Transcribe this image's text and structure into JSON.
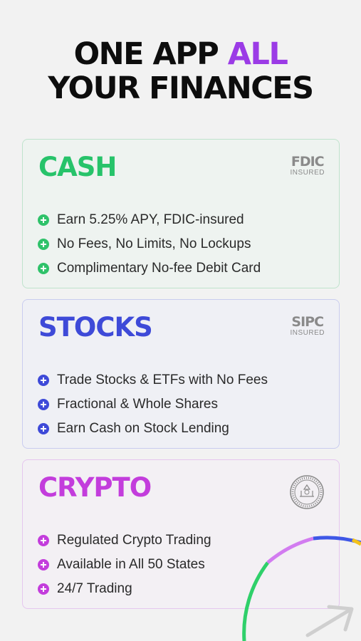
{
  "headline": {
    "line1_prefix": "ONE APP ",
    "line1_accent": "ALL",
    "line2": "YOUR FINANCES"
  },
  "colors": {
    "accent_purple": "#9b3be6",
    "cash_green": "#27c36a",
    "stocks_blue": "#3e4ad8",
    "crypto_magenta": "#c33ddc"
  },
  "cards": {
    "cash": {
      "title": "CASH",
      "badge_main": "FDIC",
      "badge_sub": "INSURED",
      "features": [
        "Earn 5.25% APY, FDIC-insured",
        "No Fees, No Limits, No Lockups",
        "Complimentary No-fee Debit Card"
      ]
    },
    "stocks": {
      "title": "STOCKS",
      "badge_main": "SIPC",
      "badge_sub": "INSURED",
      "features": [
        "Trade Stocks & ETFs with No Fees",
        "Fractional & Whole Shares",
        "Earn Cash on Stock Lending"
      ]
    },
    "crypto": {
      "title": "CRYPTO",
      "badge_icon": "state-seal-icon",
      "features": [
        "Regulated Crypto Trading",
        "Available in All 50 States",
        "24/7 Trading"
      ]
    }
  },
  "decoration": {
    "arc_icon": "gradient-ring-icon",
    "arrow_icon": "arrow-up-right-icon"
  }
}
